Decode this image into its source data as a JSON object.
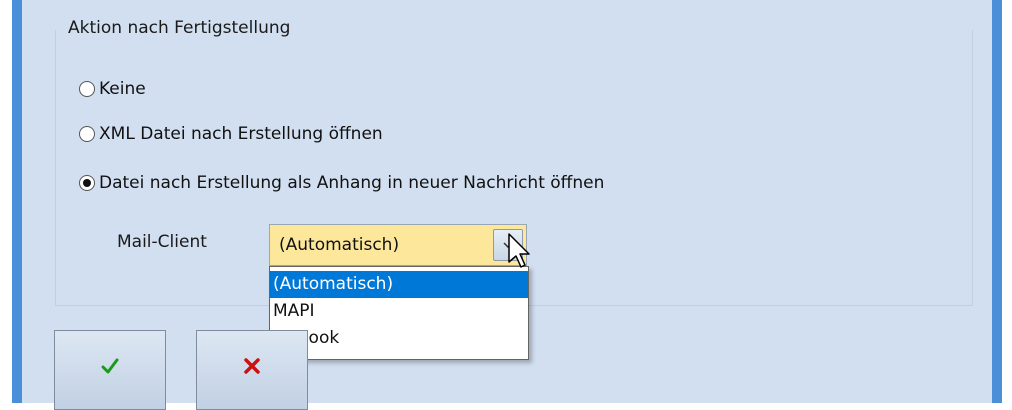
{
  "group": {
    "title": "Aktion nach Fertigstellung"
  },
  "options": [
    {
      "label": "Keine",
      "selected": false
    },
    {
      "label": "XML Datei nach Erstellung öffnen",
      "selected": false
    },
    {
      "label": "Datei nach Erstellung als Anhang in neuer Nachricht öffnen",
      "selected": true
    }
  ],
  "mail_client": {
    "label": "Mail-Client",
    "value": "(Automatisch)",
    "dropdown_options": [
      "(Automatisch)",
      "MAPI",
      "Outlook"
    ],
    "highlighted": "(Automatisch)"
  },
  "buttons": {
    "ok_icon": "checkmark-icon",
    "cancel_icon": "cross-icon",
    "ok_color": "#1a9a1a",
    "cancel_color": "#cc1111"
  },
  "colors": {
    "window_bg": "#d2dff0",
    "frame": "#4a8fd8",
    "combo_bg": "#fde79a",
    "selection": "#0078d7"
  }
}
